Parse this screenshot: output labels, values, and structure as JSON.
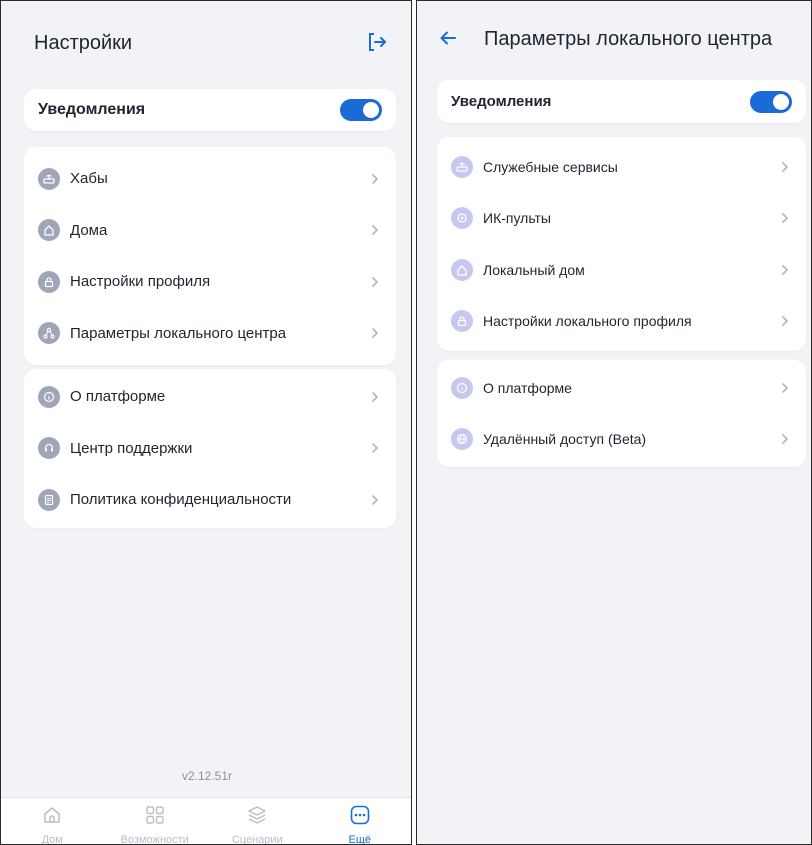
{
  "left": {
    "title": "Настройки",
    "logout_icon": "logout-icon",
    "notifications": {
      "label": "Уведомления",
      "enabled": true
    },
    "group1": [
      {
        "label": "Хабы",
        "icon": "router-icon"
      },
      {
        "label": "Дома",
        "icon": "home-icon"
      },
      {
        "label": "Настройки профиля",
        "icon": "lock-icon"
      },
      {
        "label": "Параметры локального центра",
        "icon": "hub-nodes-icon"
      }
    ],
    "group2": [
      {
        "label": "О платформе",
        "icon": "info-icon"
      },
      {
        "label": "Центр поддержки",
        "icon": "headset-icon"
      },
      {
        "label": "Политика конфиденциальности",
        "icon": "document-icon"
      }
    ],
    "version": "v2.12.51r",
    "tabs": [
      {
        "label": "Дом",
        "icon": "home-icon",
        "active": false
      },
      {
        "label": "Возможности",
        "icon": "grid-icon",
        "active": false
      },
      {
        "label": "Сценарии",
        "icon": "layers-icon",
        "active": false
      },
      {
        "label": "Ещё",
        "icon": "more-icon",
        "active": true
      }
    ]
  },
  "right": {
    "title": "Параметры локального центра",
    "back_icon": "back-arrow-icon",
    "notifications": {
      "label": "Уведомления",
      "enabled": true
    },
    "group1": [
      {
        "label": "Служебные сервисы",
        "icon": "router-icon"
      },
      {
        "label": "ИК-пульты",
        "icon": "remote-icon"
      },
      {
        "label": "Локальный дом",
        "icon": "home-icon"
      },
      {
        "label": "Настройки локального профиля",
        "icon": "lock-icon"
      }
    ],
    "group2": [
      {
        "label": "О платформе",
        "icon": "info-icon"
      },
      {
        "label": "Удалённый доступ (Beta)",
        "icon": "globe-icon"
      }
    ]
  },
  "colors": {
    "accent": "#1a6bd8",
    "background": "#f2f3f7",
    "card": "#ffffff",
    "icon_left": "#9ea6b8",
    "icon_right": "#c6c8ef"
  }
}
